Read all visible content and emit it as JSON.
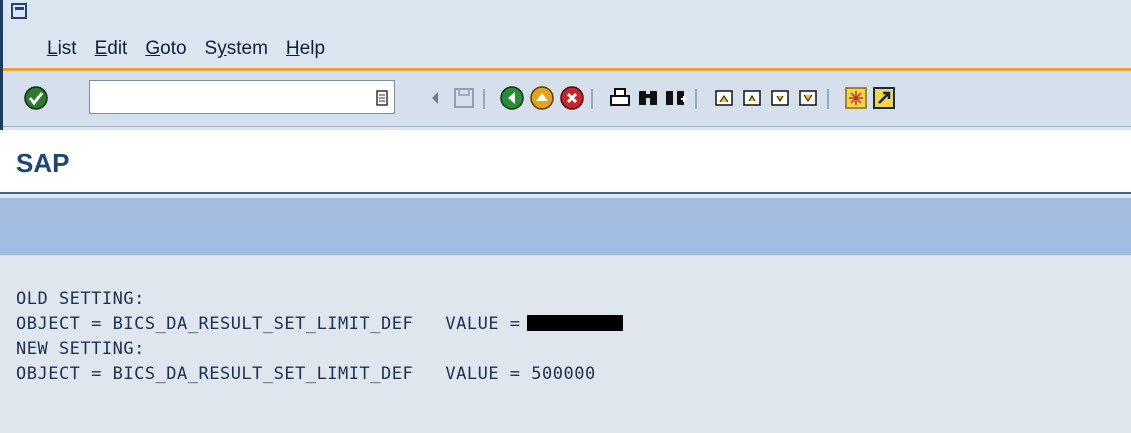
{
  "menu": {
    "items": [
      {
        "label": "List",
        "underline": "L",
        "rest": "ist"
      },
      {
        "label": "Edit",
        "underline": "E",
        "rest": "dit"
      },
      {
        "label": "Goto",
        "underline": "G",
        "rest": "oto"
      },
      {
        "label": "System",
        "underline_pre": "S",
        "underline": "y",
        "rest": "stem"
      },
      {
        "label": "Help",
        "underline": "H",
        "rest": "elp"
      }
    ]
  },
  "toolbar": {
    "command_value": "",
    "icons": [
      "enter-icon",
      "save-icon",
      "back-icon",
      "exit-icon",
      "cancel-icon",
      "print-icon",
      "find-icon",
      "find-next-icon",
      "first-page-icon",
      "previous-page-icon",
      "next-page-icon",
      "last-page-icon",
      "create-session-icon",
      "shortcut-icon"
    ]
  },
  "title": "SAP",
  "content": {
    "line1": "OLD SETTING:",
    "line2": "OBJECT = BICS_DA_RESULT_SET_LIMIT_DEF   VALUE =",
    "line3": "NEW SETTING:",
    "line4": "OBJECT = BICS_DA_RESULT_SET_LIMIT_DEF   VALUE = 500000"
  },
  "colors": {
    "accent_orange": "#e7a33b",
    "title_blue": "#1f4475",
    "appbar_blue": "#a2bddf"
  }
}
